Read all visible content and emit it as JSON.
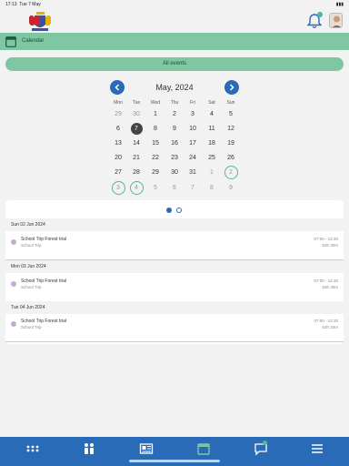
{
  "status": {
    "time": "17:13",
    "date": "Tue 7 May",
    "battery": "73%"
  },
  "section": {
    "title": "Calendar"
  },
  "filter": {
    "label": "All events"
  },
  "calendar": {
    "month": "May, 2024",
    "weekdays": [
      "Mon",
      "Tue",
      "Wed",
      "Thu",
      "Fri",
      "Sat",
      "Sun"
    ],
    "weeks": [
      [
        "29",
        "30",
        "1",
        "2",
        "3",
        "4",
        "5"
      ],
      [
        "6",
        "7",
        "8",
        "9",
        "10",
        "11",
        "12"
      ],
      [
        "13",
        "14",
        "15",
        "16",
        "17",
        "18",
        "19"
      ],
      [
        "20",
        "21",
        "22",
        "23",
        "24",
        "25",
        "26"
      ],
      [
        "27",
        "28",
        "29",
        "30",
        "31",
        "1",
        "2"
      ],
      [
        "3",
        "4",
        "5",
        "6",
        "7",
        "8",
        "9"
      ]
    ]
  },
  "events": [
    {
      "date_header": "Sun 02 Jun 2024",
      "title": "School Trip Forest trial",
      "type": "School Trip",
      "time": "07:00 - 12:30",
      "duration": "53h 30m"
    },
    {
      "date_header": "Mon 03 Jun 2024",
      "title": "School Trip Forest trial",
      "type": "School Trip",
      "time": "07:00 - 12:30",
      "duration": "53h 30m"
    },
    {
      "date_header": "Tue 04 Jun 2024",
      "title": "School Trip Forest trial",
      "type": "School Trip",
      "time": "07:00 - 12:30",
      "duration": "53h 30m"
    }
  ],
  "icons": {
    "bell": "bell-icon",
    "calendar": "calendar-icon",
    "tabs": [
      "grid-icon",
      "people-icon",
      "newspaper-icon",
      "calendar-icon",
      "chat-icon",
      "menu-icon"
    ]
  },
  "colors": {
    "primary": "#2a6bb8",
    "accent": "#7fc7a3",
    "highlight": "#4fb79a"
  }
}
